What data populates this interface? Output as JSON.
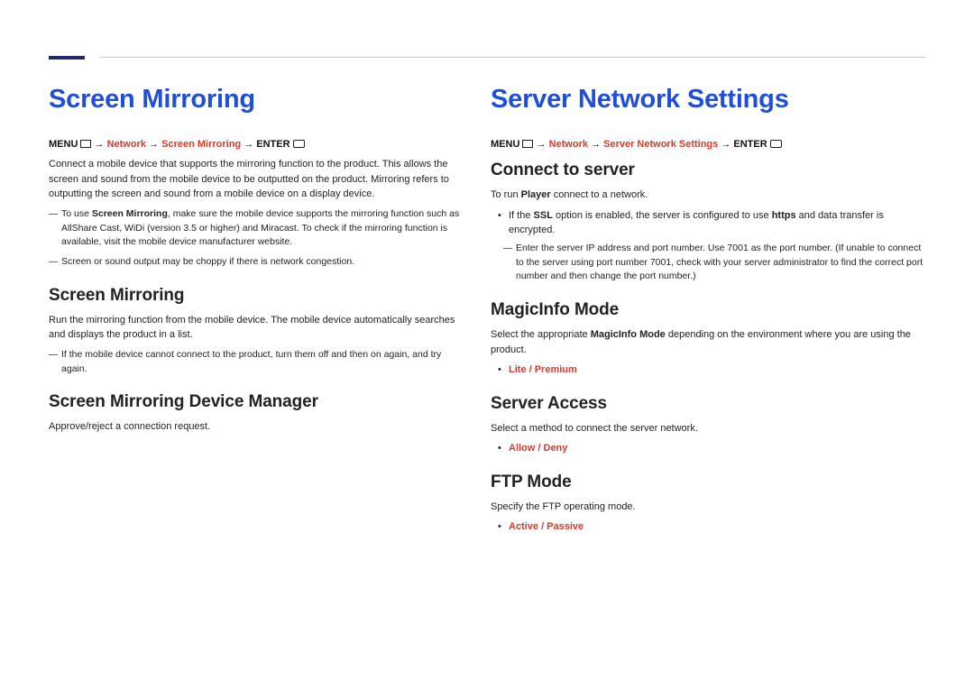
{
  "left": {
    "title": "Screen Mirroring",
    "breadcrumb": {
      "menu": "MENU",
      "p1": "Network",
      "p2": "Screen Mirroring",
      "enter": "ENTER"
    },
    "intro": "Connect a mobile device that supports the mirroring function to the product. This allows the screen and sound from the mobile device to be outputted on the product. Mirroring refers to outputting the screen and sound from a mobile device on a display device.",
    "note1a": "To use ",
    "note1b": "Screen Mirroring",
    "note1c": ", make sure the mobile device supports the mirroring function such as AllShare Cast, WiDi (version 3.5 or higher) and Miracast. To check if the mirroring function is available, visit the mobile device manufacturer website.",
    "note2": "Screen or sound output may be choppy if there is network congestion.",
    "h2a": "Screen Mirroring",
    "para2": "Run the mirroring function from the mobile device. The mobile device automatically searches and displays the product in a list.",
    "note3": "If the mobile device cannot connect to the product, turn them off and then on again, and try again.",
    "h2b": "Screen Mirroring Device Manager",
    "para3": "Approve/reject a connection request."
  },
  "right": {
    "title": "Server Network Settings",
    "breadcrumb": {
      "menu": "MENU",
      "p1": "Network",
      "p2": "Server Network Settings",
      "enter": "ENTER"
    },
    "h2a": "Connect to server",
    "para1a": "To run ",
    "para1b": "Player",
    "para1c": " connect to a network.",
    "bullet1a": "If the ",
    "bullet1b": "SSL",
    "bullet1c": " option is enabled, the server is configured to use ",
    "bullet1d": "https",
    "bullet1e": " and data transfer is encrypted.",
    "note1": "Enter the server IP address and port number. Use 7001 as the port number. (If unable to connect to the server using port number 7001, check with your server administrator to find the correct port number and then change the port number.)",
    "h2b": "MagicInfo Mode",
    "para2a": "Select the appropriate ",
    "para2b": "MagicInfo Mode",
    "para2c": " depending on the environment where you are using the product.",
    "opt2": "Lite / Premium",
    "h2c": "Server Access",
    "para3": "Select a method to connect the server network.",
    "opt3": "Allow / Deny",
    "h2d": "FTP Mode",
    "para4": "Specify the FTP operating mode.",
    "opt4": "Active / Passive"
  }
}
